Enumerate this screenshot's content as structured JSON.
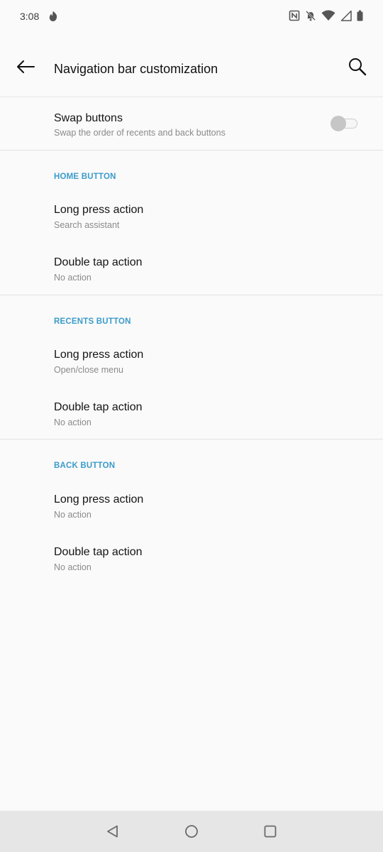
{
  "status_bar": {
    "time": "3:08",
    "app_icon": "fire-icon",
    "icons": [
      "nfc-icon",
      "bell-off-icon",
      "wifi-icon",
      "signal-icon",
      "battery-icon"
    ]
  },
  "app_bar": {
    "back_icon": "arrow-left-icon",
    "title": "Navigation bar customization",
    "search_icon": "search-icon"
  },
  "swap": {
    "title": "Swap buttons",
    "subtitle": "Swap the order of recents and back buttons",
    "enabled": false
  },
  "sections": [
    {
      "header": "HOME BUTTON",
      "items": [
        {
          "title": "Long press action",
          "subtitle": "Search assistant"
        },
        {
          "title": "Double tap action",
          "subtitle": "No action"
        }
      ]
    },
    {
      "header": "RECENTS BUTTON",
      "items": [
        {
          "title": "Long press action",
          "subtitle": "Open/close menu"
        },
        {
          "title": "Double tap action",
          "subtitle": "No action"
        }
      ]
    },
    {
      "header": "BACK BUTTON",
      "items": [
        {
          "title": "Long press action",
          "subtitle": "No action"
        },
        {
          "title": "Double tap action",
          "subtitle": "No action"
        }
      ]
    }
  ],
  "nav_bar": {
    "icons": [
      "back-triangle-icon",
      "home-circle-icon",
      "recents-square-icon"
    ]
  },
  "colors": {
    "accent": "#3b9bcb",
    "background": "#fafafa",
    "nav_bar": "#e6e6e6"
  }
}
